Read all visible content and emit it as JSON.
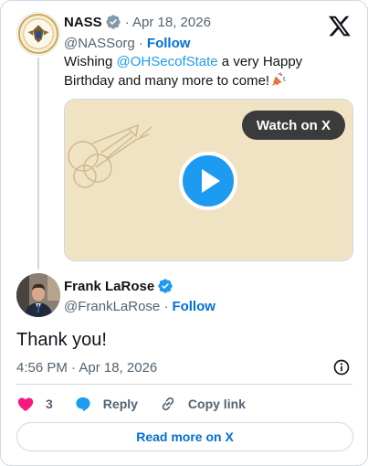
{
  "parent_tweet": {
    "author_name": "NASS",
    "date": "· Apr 18, 2026",
    "handle": "@NASSorg ·",
    "follow_label": "Follow",
    "text_before": "Wishing ",
    "mention": "@OHSecofState",
    "text_after": " a very Happy Birthday and many more to come!",
    "media": {
      "watch_label": "Watch on X"
    }
  },
  "reply_tweet": {
    "author_name": "Frank LaRose",
    "handle": "@FrankLaRose ·",
    "follow_label": "Follow",
    "text": "Thank you!",
    "timestamp": "4:56 PM · Apr 18, 2026",
    "actions": {
      "like_count": "3",
      "reply_label": "Reply",
      "copy_link_label": "Copy link"
    },
    "read_more_label": "Read more on X"
  },
  "icons": [
    "x-logo-icon",
    "verified-badge-icon",
    "party-popper-icon",
    "play-icon",
    "info-icon",
    "heart-icon",
    "reply-bubble-icon",
    "link-icon"
  ],
  "colors": {
    "accent": "#1d9bf0",
    "link": "#006fd6",
    "heart": "#f91880",
    "muted": "#536471",
    "media_bg": "#efe3c4"
  }
}
